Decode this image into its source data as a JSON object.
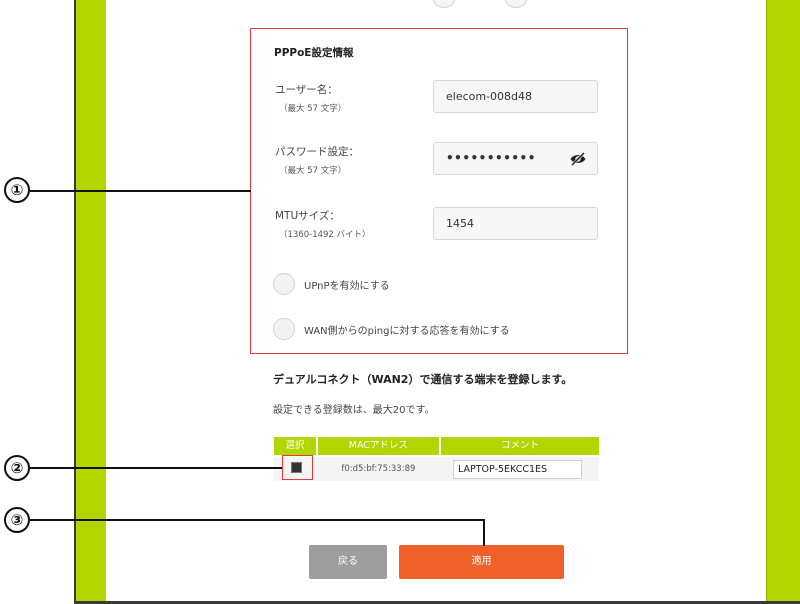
{
  "pppoe": {
    "title": "PPPoE設定情報",
    "username": {
      "label": "ユーザー名：",
      "hint": "（最大 57 文字）",
      "value": "elecom-008d48"
    },
    "password": {
      "label": "パスワード設定：",
      "hint": "（最大 57 文字）",
      "value": "•••••••••••"
    },
    "mtu": {
      "label": "MTUサイズ：",
      "hint": "（1360-1492 バイト）",
      "value": "1454"
    },
    "upnp_label": "UPnPを有効にする",
    "ping_label": "WAN側からのpingに対する応答を有効にする"
  },
  "dual_connect": {
    "title": "デュアルコネクト（WAN2）で通信する端末を登録します。",
    "description": "設定できる登録数は、最大20です。",
    "table": {
      "headers": [
        "選択",
        "MACアドレス",
        "コメント"
      ],
      "rows": [
        {
          "selected": true,
          "mac": "f0:d5:bf:75:33:89",
          "comment": "LAPTOP-5EKCC1ES"
        }
      ]
    }
  },
  "buttons": {
    "back": "戻る",
    "apply": "適用"
  },
  "callouts": [
    "①",
    "②",
    "③"
  ],
  "colors": {
    "accent_green": "#b3d600",
    "apply_orange": "#f0602a",
    "highlight_red": "#e53a3a",
    "back_gray": "#9e9e9e"
  }
}
